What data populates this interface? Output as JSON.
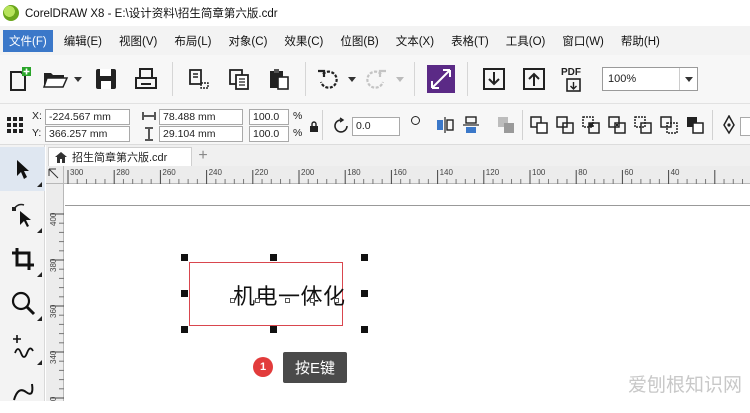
{
  "window": {
    "title": "CorelDRAW X8 - E:\\设计资料\\招生简章第六版.cdr"
  },
  "menu": [
    {
      "label": "文件(F)",
      "active": true
    },
    {
      "label": "编辑(E)"
    },
    {
      "label": "视图(V)"
    },
    {
      "label": "布局(L)"
    },
    {
      "label": "对象(C)"
    },
    {
      "label": "效果(C)"
    },
    {
      "label": "位图(B)"
    },
    {
      "label": "文本(X)"
    },
    {
      "label": "表格(T)"
    },
    {
      "label": "工具(O)"
    },
    {
      "label": "窗口(W)"
    },
    {
      "label": "帮助(H)"
    }
  ],
  "toolbar": {
    "zoom_value": "100%",
    "pdf_label": "PDF"
  },
  "propbar": {
    "x_label": "X:",
    "x_value": "-224.567 mm",
    "y_label": "Y:",
    "y_value": "366.257 mm",
    "width_value": "78.488 mm",
    "height_value": "29.104 mm",
    "scale_x": "100.0",
    "scale_y": "100.0",
    "percent_1": "%",
    "percent_2": "%",
    "rotation": "0.0"
  },
  "document_tab": {
    "label": "招生简章第六版.cdr"
  },
  "ruler": {
    "h_ticks": [
      "300",
      "280",
      "260",
      "240",
      "220",
      "200",
      "180",
      "160",
      "140",
      "120",
      "100",
      "80",
      "60",
      "40"
    ],
    "v_ticks": [
      "400",
      "380",
      "360",
      "340",
      "320"
    ]
  },
  "canvas": {
    "text": "机电一体化"
  },
  "tip": {
    "step": "1",
    "text": "按E键"
  },
  "watermark": "爱刨根知识网",
  "colors": {
    "menu_active": "#3b78c9",
    "frame": "#d9464e",
    "badge": "#e23b3b",
    "tip_bg": "#4a4a4a"
  }
}
